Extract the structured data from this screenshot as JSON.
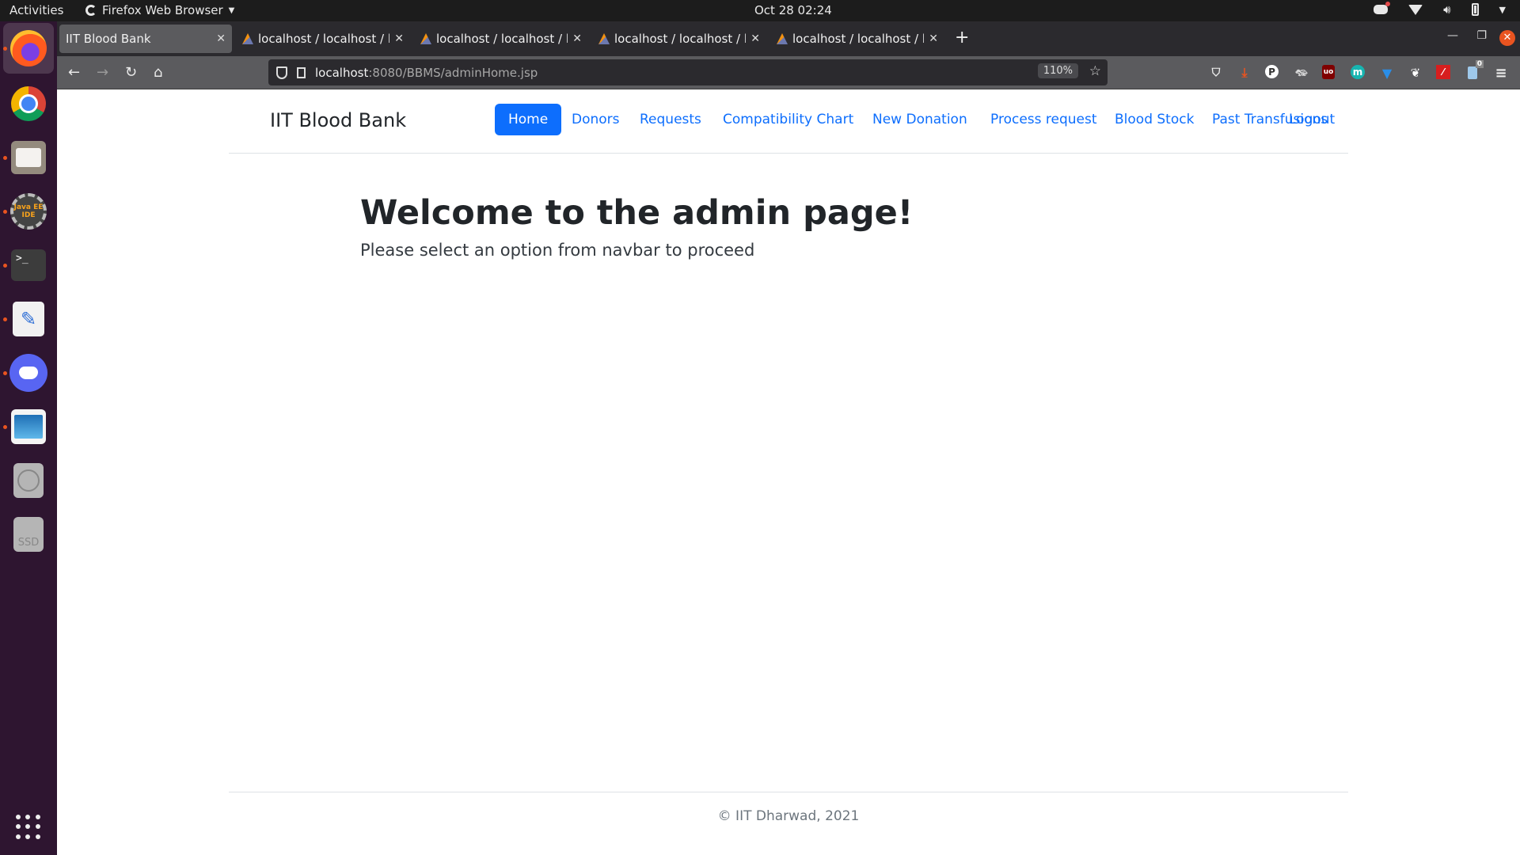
{
  "system_bar": {
    "activities": "Activities",
    "app_name": "Firefox Web Browser",
    "clock": "Oct 28  02:24"
  },
  "dock": {
    "items": [
      {
        "name": "Firefox",
        "running": true,
        "active": true
      },
      {
        "name": "Google Chrome",
        "running": false
      },
      {
        "name": "Files",
        "running": true
      },
      {
        "name": "Java EE IDE",
        "running": true,
        "label": "Java EE IDE"
      },
      {
        "name": "Terminal",
        "running": true,
        "label": ">_"
      },
      {
        "name": "Text Editor",
        "running": true
      },
      {
        "name": "Discord",
        "running": true
      },
      {
        "name": "Image Viewer",
        "running": true
      },
      {
        "name": "Disc",
        "running": false
      },
      {
        "name": "SSD",
        "running": false,
        "label": "SSD"
      }
    ]
  },
  "browser": {
    "tabs": [
      {
        "title": "IIT Blood Bank",
        "active": true
      },
      {
        "title": "localhost / localhost / blo",
        "active": false
      },
      {
        "title": "localhost / localhost / blo",
        "active": false
      },
      {
        "title": "localhost / localhost / blo",
        "active": false
      },
      {
        "title": "localhost / localhost / blo",
        "active": false
      }
    ],
    "url_host": "localhost",
    "url_path": ":8080/BBMS/adminHome.jsp",
    "zoom": "110%",
    "extensions_badge": "0"
  },
  "site": {
    "brand": "IIT Blood Bank",
    "nav": [
      {
        "label": "Home",
        "active": true
      },
      {
        "label": "Donors"
      },
      {
        "label": "Requests"
      },
      {
        "label": "Compatibility Chart"
      },
      {
        "label": "New Donation"
      },
      {
        "label": "Process request"
      },
      {
        "label": "Blood Stock"
      },
      {
        "label": "Past Transfusions"
      },
      {
        "label": "Logout"
      }
    ],
    "heading": "Welcome to the admin page!",
    "subheading": "Please select an option from navbar to proceed",
    "footer": "© IIT Dharwad, 2021"
  },
  "colors": {
    "accent": "#0d6efd",
    "os_accent": "#e95420"
  }
}
